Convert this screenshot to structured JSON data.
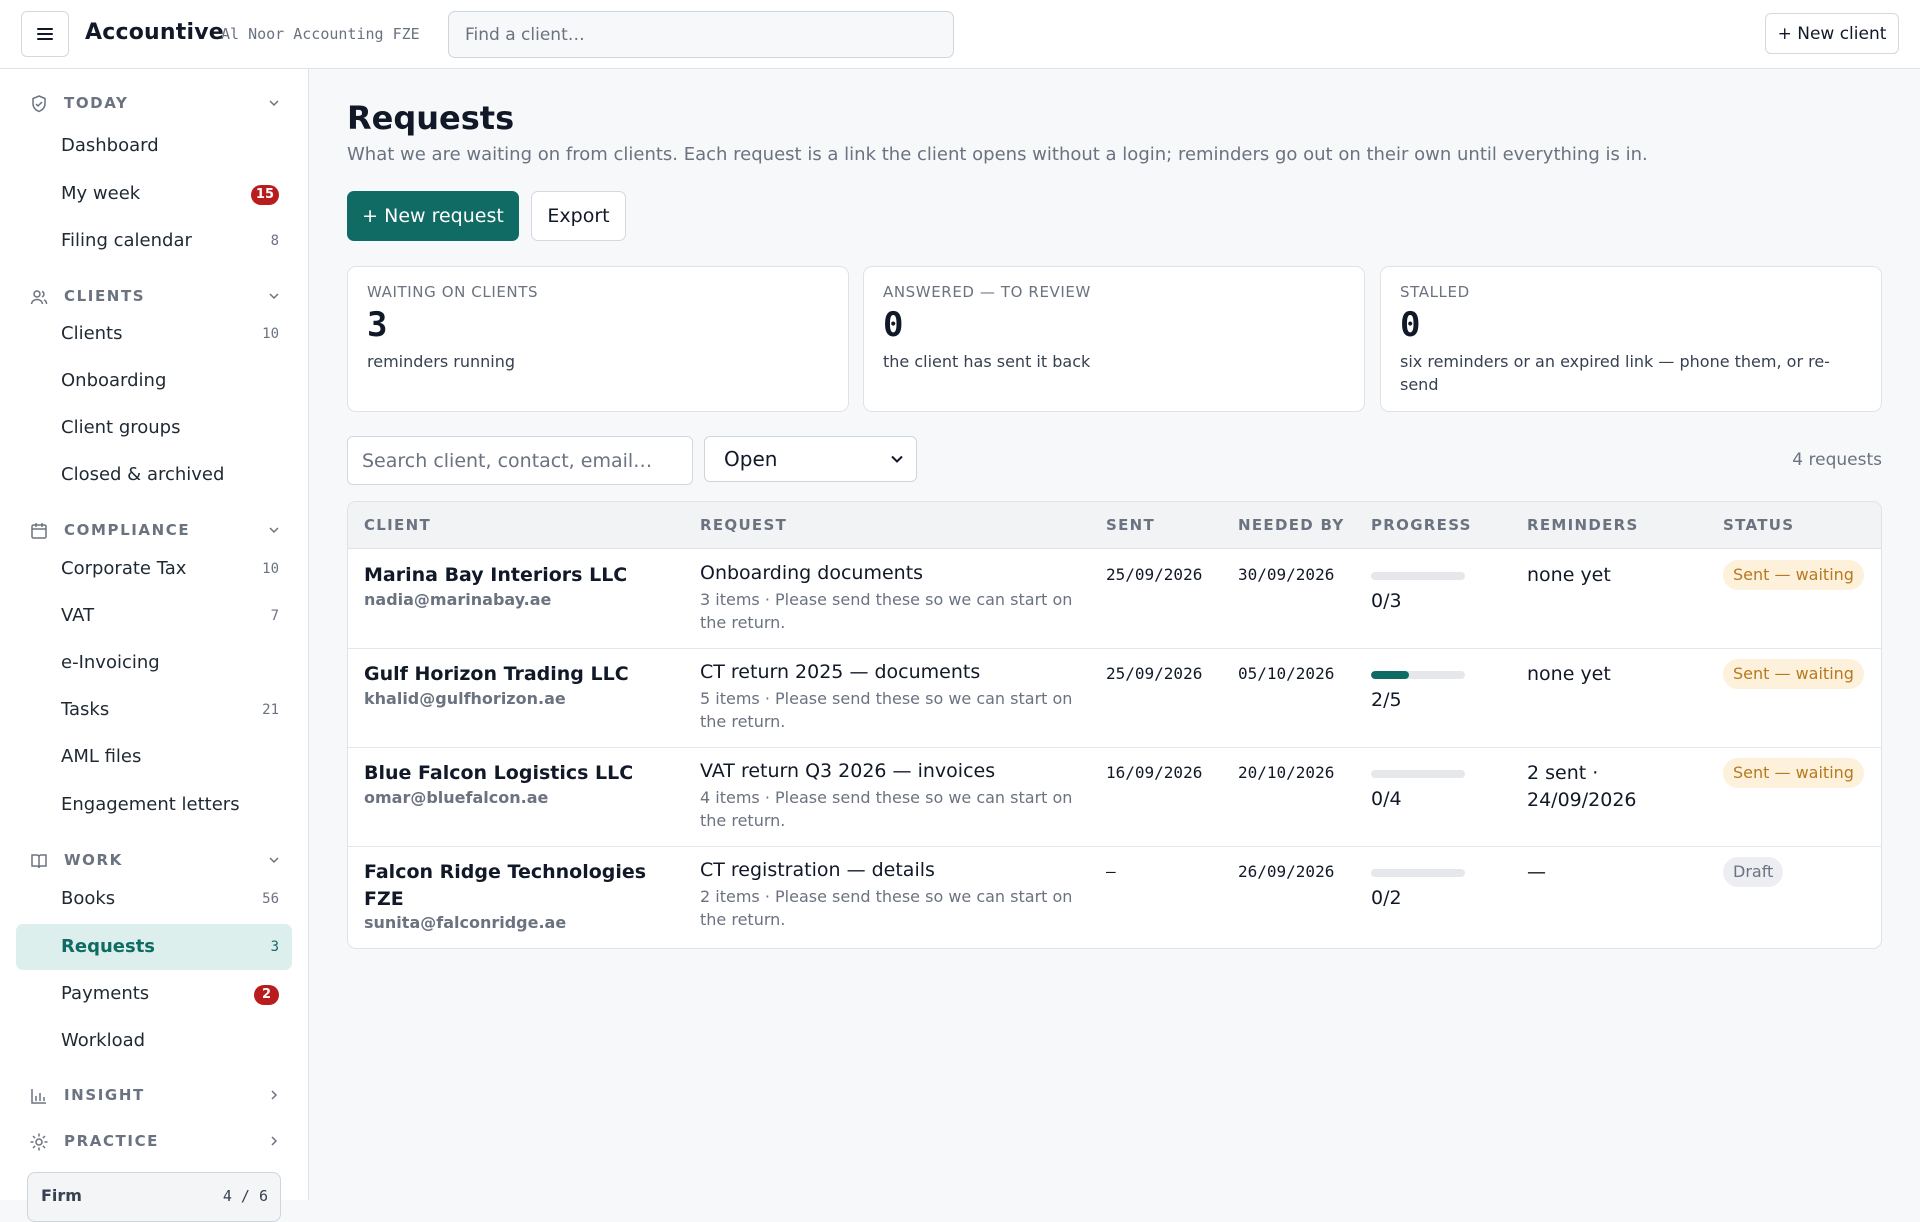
{
  "header": {
    "brand": "Accountive",
    "firm": "Al Noor Accounting FZE",
    "find_placeholder": "Find a client…",
    "new_client": "+ New client"
  },
  "sidebar": {
    "sections": [
      {
        "title": "TODAY",
        "icon": "shield-check-icon",
        "expanded": true
      },
      {
        "title": "CLIENTS",
        "icon": "users-icon",
        "expanded": true
      },
      {
        "title": "COMPLIANCE",
        "icon": "calendar-icon",
        "expanded": true
      },
      {
        "title": "WORK",
        "icon": "book-icon",
        "expanded": true
      },
      {
        "title": "INSIGHT",
        "icon": "bar-chart-icon",
        "expanded": false
      },
      {
        "title": "PRACTICE",
        "icon": "gear-icon",
        "expanded": false
      }
    ],
    "items": [
      {
        "label": "Dashboard",
        "count": ""
      },
      {
        "label": "My week",
        "badge": "15"
      },
      {
        "label": "Filing calendar",
        "count": "8"
      },
      {
        "label": "Clients",
        "count": "10"
      },
      {
        "label": "Onboarding",
        "count": ""
      },
      {
        "label": "Client groups",
        "count": ""
      },
      {
        "label": "Closed & archived",
        "count": ""
      },
      {
        "label": "Corporate Tax",
        "count": "10"
      },
      {
        "label": "VAT",
        "count": "7"
      },
      {
        "label": "e-Invoicing",
        "count": ""
      },
      {
        "label": "Tasks",
        "count": "21"
      },
      {
        "label": "AML files",
        "count": ""
      },
      {
        "label": "Engagement letters",
        "count": ""
      },
      {
        "label": "Books",
        "count": "56"
      },
      {
        "label": "Requests",
        "count": "3",
        "active": true
      },
      {
        "label": "Payments",
        "badge": "2"
      },
      {
        "label": "Workload",
        "count": ""
      }
    ],
    "firm_box": {
      "label": "Firm",
      "value": "4 / 6"
    }
  },
  "main": {
    "title": "Requests",
    "subtitle": "What we are waiting on from clients. Each request is a link the client opens without a login; reminders go out on their own until everything is in.",
    "new_request": "+ New request",
    "export": "Export",
    "cards": [
      {
        "label": "WAITING ON CLIENTS",
        "value": "3",
        "note": "reminders running"
      },
      {
        "label": "ANSWERED — TO REVIEW",
        "value": "0",
        "note": "the client has sent it back"
      },
      {
        "label": "STALLED",
        "value": "0",
        "note": "six reminders or an expired link — phone them, or re-send"
      }
    ],
    "search_placeholder": "Search client, contact, email…",
    "filter": "Open",
    "count": "4 requests",
    "columns": [
      "CLIENT",
      "REQUEST",
      "SENT",
      "NEEDED BY",
      "PROGRESS",
      "REMINDERS",
      "STATUS"
    ],
    "rows": [
      {
        "client": "Marina Bay Interiors LLC",
        "email": "nadia@marinabay.ae",
        "request": "Onboarding documents",
        "detail": "3 items · Please send these so we can start on the return.",
        "sent": "25/09/2026",
        "needed": "30/09/2026",
        "progress": "0/3",
        "progress_fraction": 0,
        "reminders": "none yet",
        "status": "Sent — waiting",
        "status_kind": "waiting"
      },
      {
        "client": "Gulf Horizon Trading LLC",
        "email": "khalid@gulfhorizon.ae",
        "request": "CT return 2025 — documents",
        "detail": "5 items · Please send these so we can start on the return.",
        "sent": "25/09/2026",
        "needed": "05/10/2026",
        "progress": "2/5",
        "progress_fraction": 0.4,
        "reminders": "none yet",
        "status": "Sent — waiting",
        "status_kind": "waiting"
      },
      {
        "client": "Blue Falcon Logistics LLC",
        "email": "omar@bluefalcon.ae",
        "request": "VAT return Q3 2026 — invoices",
        "detail": "4 items · Please send these so we can start on the return.",
        "sent": "16/09/2026",
        "needed": "20/10/2026",
        "progress": "0/4",
        "progress_fraction": 0,
        "reminders": "2 sent · 24/09/2026",
        "status": "Sent — waiting",
        "status_kind": "waiting"
      },
      {
        "client": "Falcon Ridge Technologies FZE",
        "email": "sunita@falconridge.ae",
        "request": "CT registration — details",
        "detail": "2 items · Please send these so we can start on the return.",
        "sent": "–",
        "needed": "26/09/2026",
        "progress": "0/2",
        "progress_fraction": 0,
        "reminders": "—",
        "status": "Draft",
        "status_kind": "draft"
      }
    ]
  },
  "colors": {
    "accent": "#0f6b63",
    "badge": "#b91c1c",
    "waiting_bg": "#fdf1dc",
    "waiting_text": "#b7791f"
  }
}
